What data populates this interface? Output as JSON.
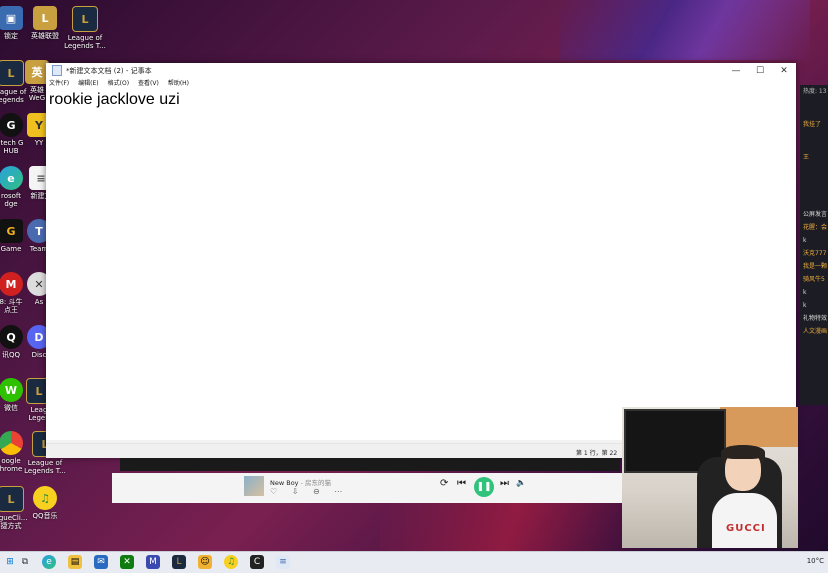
{
  "desktop": {
    "icons": [
      {
        "name": "desktop-icon-1",
        "label": "锁定"
      },
      {
        "name": "desktop-icon-2",
        "label": "英雄联盟"
      },
      {
        "name": "desktop-icon-3",
        "label": "League of\nLegends T..."
      },
      {
        "name": "desktop-icon-4",
        "label": "eague of\negends"
      },
      {
        "name": "desktop-icon-5",
        "label": "英雄\nWeG"
      },
      {
        "name": "desktop-icon-6",
        "label": "itech G\nHUB"
      },
      {
        "name": "desktop-icon-7",
        "label": "YY"
      },
      {
        "name": "desktop-icon-8",
        "label": "rosoft\ndge"
      },
      {
        "name": "desktop-icon-9",
        "label": "新建文"
      },
      {
        "name": "desktop-icon-10",
        "label": "Game"
      },
      {
        "name": "desktop-icon-11",
        "label": "Team"
      },
      {
        "name": "desktop-icon-12",
        "label": "8: 斗牛\n点王"
      },
      {
        "name": "desktop-icon-13",
        "label": "As"
      },
      {
        "name": "desktop-icon-14",
        "label": "讯QQ"
      },
      {
        "name": "desktop-icon-15",
        "label": "Disc"
      },
      {
        "name": "desktop-icon-16",
        "label": "微信"
      },
      {
        "name": "desktop-icon-17",
        "label": "Leag\nLegen"
      },
      {
        "name": "desktop-icon-18",
        "label": "oogle\nhrome"
      },
      {
        "name": "desktop-icon-19",
        "label": "League of\nLegends T..."
      },
      {
        "name": "desktop-icon-20",
        "label": "agueCli...\n捷方式"
      },
      {
        "name": "desktop-icon-21",
        "label": "QQ音乐"
      }
    ]
  },
  "notepad": {
    "title": "*新建文本文档 (2) - 记事本",
    "menu": [
      "文件(F)",
      "编辑(E)",
      "格式(O)",
      "查看(V)",
      "帮助(H)"
    ],
    "content": "rookie jacklove uzi",
    "status": "第 1 行，第 22",
    "controls": {
      "minimize": "—",
      "maximize": "☐",
      "close": "✕"
    }
  },
  "player": {
    "song": "New Boy",
    "artist": " - 房东的猫",
    "icons": "♡ ⇩ ⊖ ⋯",
    "prev": "⏮",
    "play": "❚❚",
    "next": "⏭",
    "loop": "⟳",
    "volume": "🔈"
  },
  "chat": {
    "lines": [
      "热度: 13",
      "我挂了",
      "王",
      "公屏发言",
      "花腥：会",
      "k",
      "沃克777",
      "我是一颗",
      "骑风牛5",
      "k",
      "k",
      "礼物特效",
      "人文漫画"
    ]
  },
  "webcam": {
    "shirt_text": "GUCCI"
  },
  "taskbar": {
    "weather": "10°C"
  },
  "colors": {
    "accent_green": "#31c27c",
    "wallpaper": "#5a1a4a"
  }
}
